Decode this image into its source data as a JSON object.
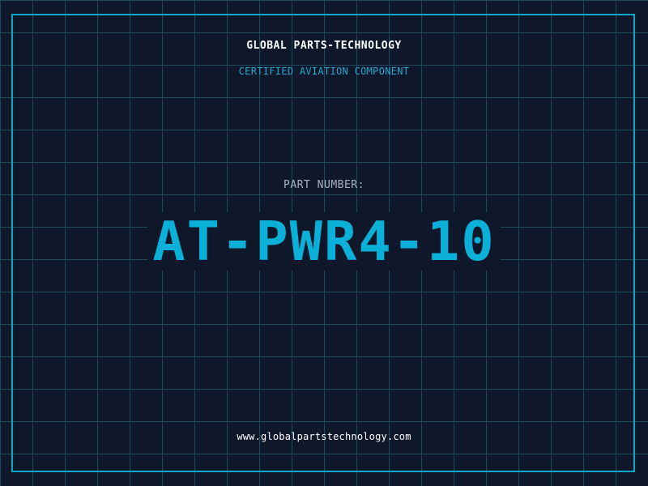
{
  "header": {
    "company": "GLOBAL PARTS-TECHNOLOGY",
    "subtitle": "CERTIFIED AVIATION COMPONENT"
  },
  "part": {
    "label": "PART NUMBER:",
    "number": "AT-PWR4-10"
  },
  "footer": {
    "url": "www.globalpartstechnology.com"
  },
  "colors": {
    "background": "#0f172a",
    "grid": "#1c4a5e",
    "accent": "#0ab0d8",
    "frame": "#0ea5c9"
  }
}
